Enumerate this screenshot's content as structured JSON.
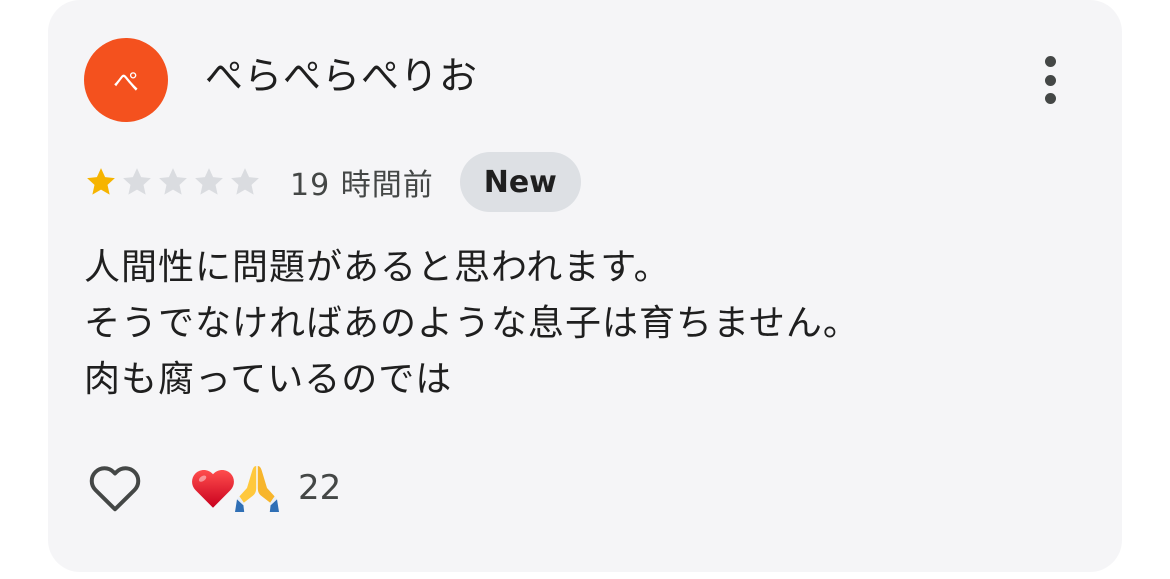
{
  "review": {
    "avatar_letter": "ぺ",
    "avatar_color": "#f4511e",
    "username": "ぺらぺらぺりお",
    "more_icon": "more-vert-icon",
    "rating": 1,
    "rating_max": 5,
    "star_filled_color": "#f6b400",
    "star_empty_color": "#dadce0",
    "time_ago": "19 時間前",
    "badge": "New",
    "text_lines": [
      "人間性に問題があると思われます。",
      "そうでなければあのような息子は育ちません。",
      "肉も腐っているのでは"
    ],
    "like_icon": "heart-outline-icon",
    "reactions": {
      "icons": [
        "red-heart-icon",
        "praying-hands-icon"
      ],
      "count": "22"
    }
  }
}
